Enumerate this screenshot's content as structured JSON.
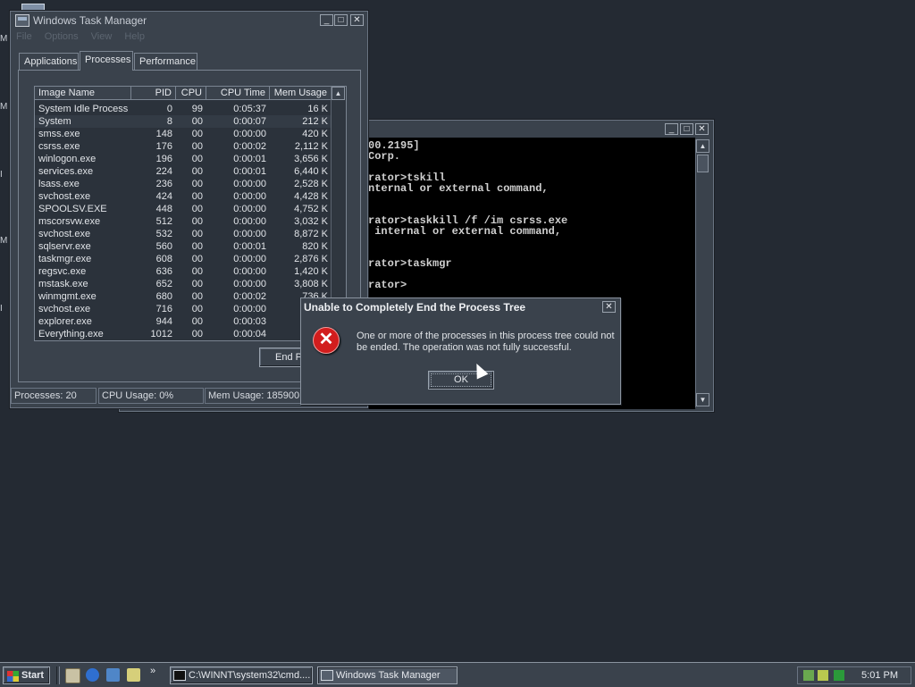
{
  "taskmgr": {
    "title": "Windows Task Manager",
    "menu": [
      "File",
      "Options",
      "View",
      "Help"
    ],
    "tabs": [
      "Applications",
      "Processes",
      "Performance"
    ],
    "active_tab": "Processes",
    "columns": [
      "Image Name",
      "PID",
      "CPU",
      "CPU Time",
      "Mem Usage"
    ],
    "processes": [
      {
        "name": "System Idle Process",
        "pid": "0",
        "cpu": "99",
        "time": "0:05:37",
        "mem": "16 K"
      },
      {
        "name": "System",
        "pid": "8",
        "cpu": "00",
        "time": "0:00:07",
        "mem": "212 K"
      },
      {
        "name": "smss.exe",
        "pid": "148",
        "cpu": "00",
        "time": "0:00:00",
        "mem": "420 K"
      },
      {
        "name": "csrss.exe",
        "pid": "176",
        "cpu": "00",
        "time": "0:00:02",
        "mem": "2,112 K"
      },
      {
        "name": "winlogon.exe",
        "pid": "196",
        "cpu": "00",
        "time": "0:00:01",
        "mem": "3,656 K"
      },
      {
        "name": "services.exe",
        "pid": "224",
        "cpu": "00",
        "time": "0:00:01",
        "mem": "6,440 K"
      },
      {
        "name": "lsass.exe",
        "pid": "236",
        "cpu": "00",
        "time": "0:00:00",
        "mem": "2,528 K"
      },
      {
        "name": "svchost.exe",
        "pid": "424",
        "cpu": "00",
        "time": "0:00:00",
        "mem": "4,428 K"
      },
      {
        "name": "SPOOLSV.EXE",
        "pid": "448",
        "cpu": "00",
        "time": "0:00:00",
        "mem": "4,752 K"
      },
      {
        "name": "mscorsvw.exe",
        "pid": "512",
        "cpu": "00",
        "time": "0:00:00",
        "mem": "3,032 K"
      },
      {
        "name": "svchost.exe",
        "pid": "532",
        "cpu": "00",
        "time": "0:00:00",
        "mem": "8,872 K"
      },
      {
        "name": "sqlservr.exe",
        "pid": "560",
        "cpu": "00",
        "time": "0:00:01",
        "mem": "820 K"
      },
      {
        "name": "taskmgr.exe",
        "pid": "608",
        "cpu": "00",
        "time": "0:00:00",
        "mem": "2,876 K"
      },
      {
        "name": "regsvc.exe",
        "pid": "636",
        "cpu": "00",
        "time": "0:00:00",
        "mem": "1,420 K"
      },
      {
        "name": "mstask.exe",
        "pid": "652",
        "cpu": "00",
        "time": "0:00:00",
        "mem": "3,808 K"
      },
      {
        "name": "winmgmt.exe",
        "pid": "680",
        "cpu": "00",
        "time": "0:00:02",
        "mem": "736 K"
      },
      {
        "name": "svchost.exe",
        "pid": "716",
        "cpu": "00",
        "time": "0:00:00",
        "mem": "63"
      },
      {
        "name": "explorer.exe",
        "pid": "944",
        "cpu": "00",
        "time": "0:00:03",
        "mem": "3"
      },
      {
        "name": "Everything.exe",
        "pid": "1012",
        "cpu": "00",
        "time": "0:00:04",
        "mem": "6,"
      }
    ],
    "end_button": "End P",
    "status": {
      "processes": "Processes: 20",
      "cpu": "CPU Usage: 0%",
      "mem": "Mem Usage: 185900K"
    }
  },
  "console": {
    "lines": [
      "00.2195]",
      "Corp.",
      "",
      "rator>tskill",
      "nternal or external command,",
      "",
      "",
      "rator>taskkill /f /im csrss.exe",
      " internal or external command,",
      "",
      "",
      "rator>taskmgr",
      "",
      "rator>"
    ]
  },
  "dialog": {
    "title": "Unable to Completely End the Process Tree",
    "message": "One or more of the processes in this process tree could not be ended.  The operation was not fully successful.",
    "ok": "OK"
  },
  "taskbar": {
    "start": "Start",
    "tasks": [
      "C:\\WINNT\\system32\\cmd....",
      "Windows Task Manager"
    ],
    "clock": "5:01 PM"
  },
  "colors": {
    "desktop": "#242a33",
    "window": "#3a424c",
    "error_icon": "#d21d1d"
  }
}
